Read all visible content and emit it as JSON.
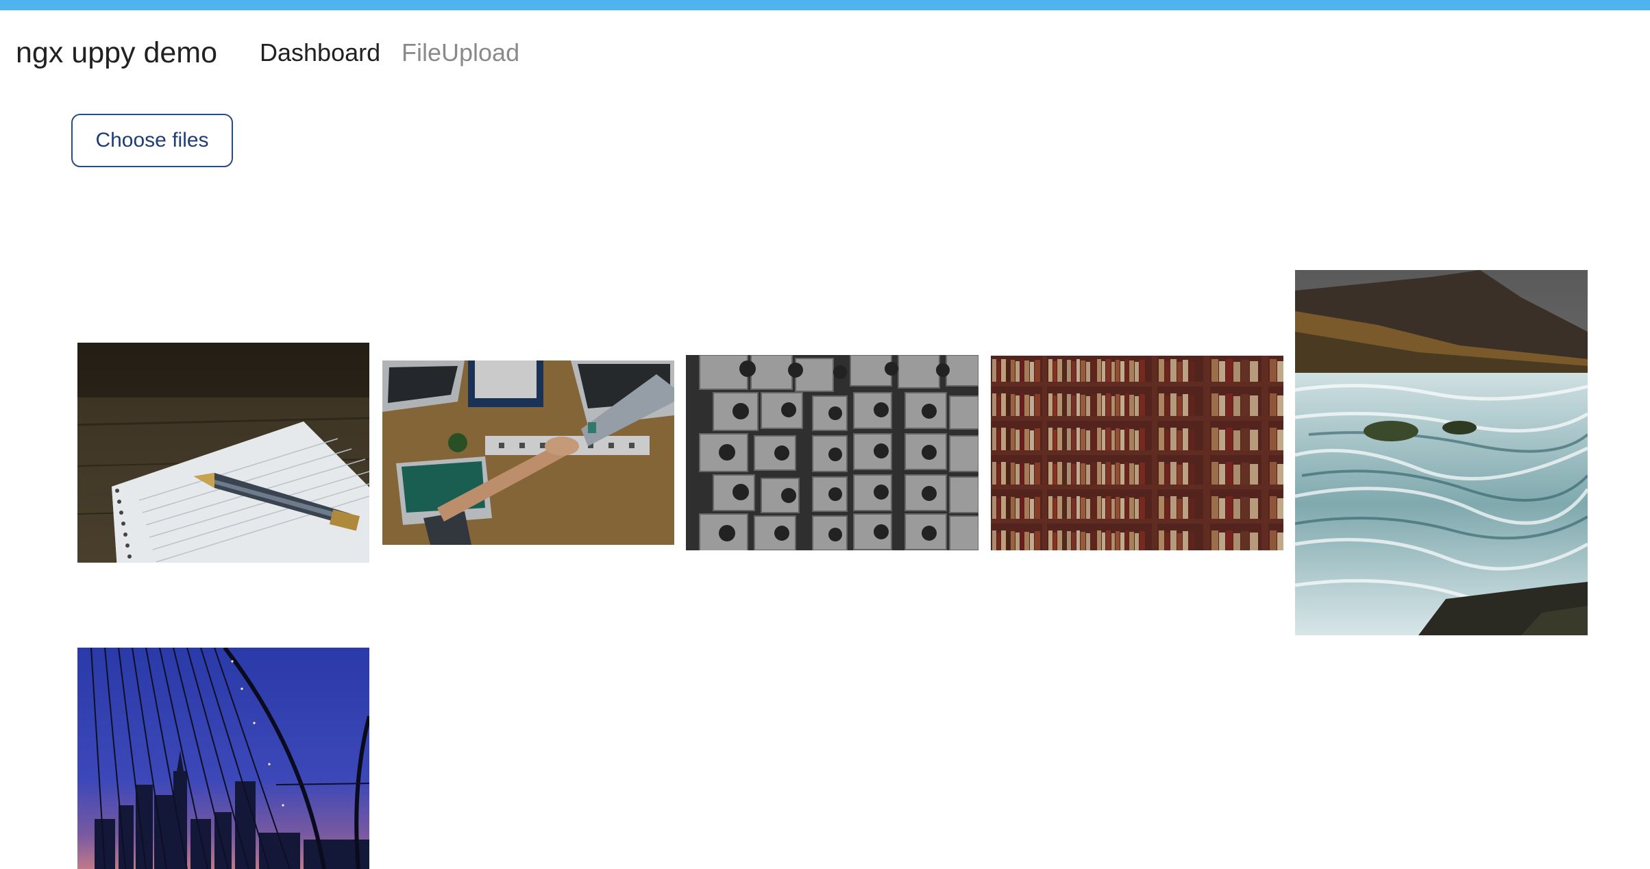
{
  "navbar": {
    "brand": "ngx uppy demo",
    "links": [
      {
        "label": "Dashboard",
        "active": true
      },
      {
        "label": "FileUpload",
        "active": false
      }
    ],
    "accent_color": "#4fb3f0"
  },
  "upload": {
    "button_label": "Choose files"
  },
  "gallery": {
    "images": [
      {
        "subject": "notebook with fountain pen on wooden table"
      },
      {
        "subject": "handshake over desk with laptops"
      },
      {
        "subject": "grayscale capsule tower facade"
      },
      {
        "subject": "library bookshelves"
      },
      {
        "subject": "waterfall and rushing river under cliffs"
      },
      {
        "subject": "bridge cables with city skyline at dusk"
      }
    ]
  }
}
